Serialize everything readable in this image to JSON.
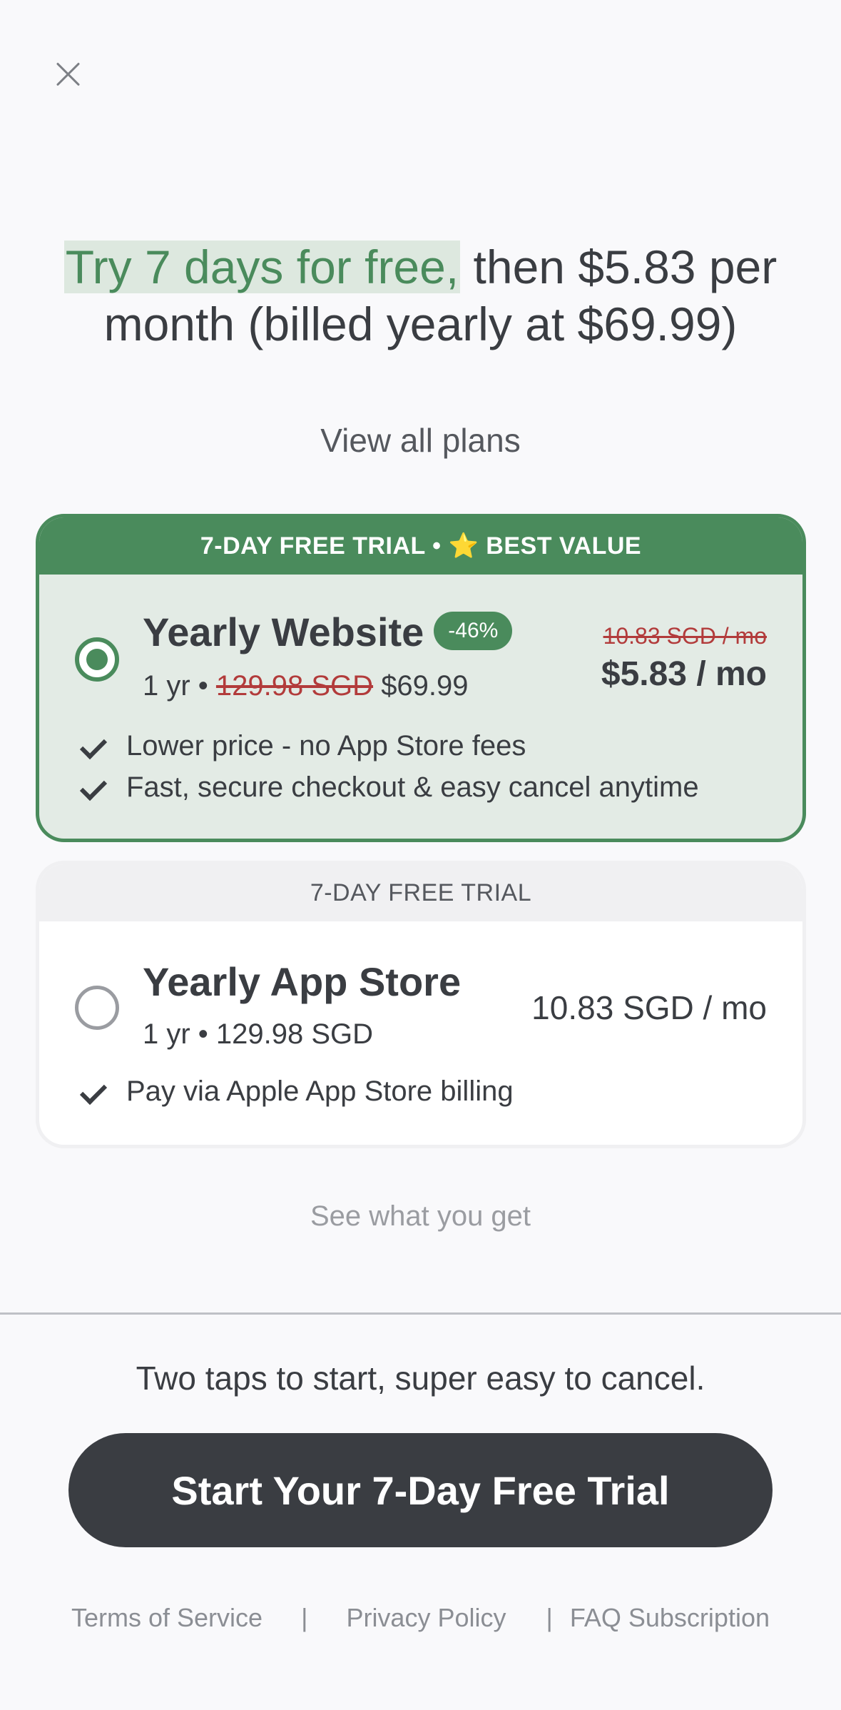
{
  "icons": {
    "close": "close-icon",
    "check": "check-icon"
  },
  "colors": {
    "accent": "#4a8b5c",
    "dark": "#3a3d42",
    "strike": "#b23b3b"
  },
  "headline": {
    "highlight": "Try 7 days for free,",
    "rest": " then $5.83 per month (billed yearly at $69.99)"
  },
  "view_all_plans": "View all plans",
  "plans": [
    {
      "banner": "7-DAY FREE TRIAL • ⭐ BEST VALUE",
      "name": "Yearly Website",
      "badge": "-46%",
      "term": "1 yr •",
      "old_total": "129.98 SGD",
      "new_total": "$69.99",
      "old_monthly": "10.83 SGD / mo",
      "monthly": "$5.83 / mo",
      "selected": true,
      "features": [
        "Lower price - no App Store fees",
        "Fast, secure checkout & easy cancel anytime"
      ]
    },
    {
      "banner": "7-DAY FREE TRIAL",
      "name": "Yearly App Store",
      "subtitle": "1 yr • 129.98 SGD",
      "monthly": "10.83 SGD / mo",
      "selected": false,
      "features": [
        "Pay via Apple App Store billing"
      ]
    }
  ],
  "see_what_you_get": "See what you get",
  "tagline": "Two taps to start, super easy to cancel.",
  "cta": "Start Your 7-Day Free Trial",
  "footer": {
    "terms": "Terms of Service",
    "privacy": "Privacy Policy",
    "faq": "FAQ Subscription",
    "separator": "|"
  }
}
